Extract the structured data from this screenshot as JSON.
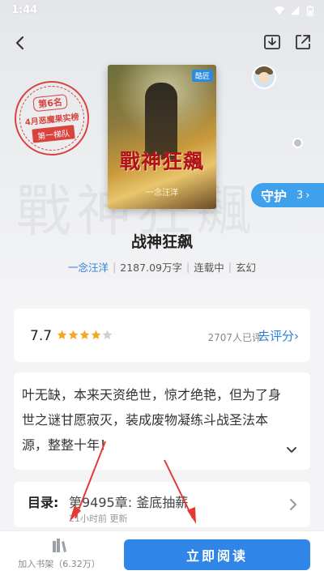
{
  "status_bar": {
    "time": "1:44"
  },
  "seal": {
    "rank": "第6名",
    "list": "4月恶魔果实榜",
    "tier": "第一梯队"
  },
  "cover": {
    "title": "戰神狂飆",
    "badge": "酷匠",
    "author": "一念汪洋"
  },
  "guard": {
    "label": "守护",
    "count": "3"
  },
  "book": {
    "title": "战神狂飙",
    "author": "一念汪洋",
    "word_count": "2187.09万字",
    "status": "连载中",
    "genre": "玄幻"
  },
  "rating": {
    "score": "7.7",
    "stars": 4,
    "count_text": "2707人已评",
    "rate_link": "去评分"
  },
  "description": "叶无缺，本来天资绝世，惊才绝艳，但为了身世之谜甘愿寂灭，装成废物凝练斗战圣法本源，整整十年！",
  "toc": {
    "label": "目录:",
    "chapter": "第9495章: 釜底抽薪",
    "updated": "21小时前 更新"
  },
  "bottom": {
    "shelf_label": "加入书架（6.32万）",
    "read_label": "立即阅读"
  },
  "colors": {
    "accent": "#2f86e6",
    "seal": "#d9433d",
    "annotation_arrow": "#e53935"
  },
  "icons": [
    "back-icon",
    "download-icon",
    "share-icon",
    "chevron-down-icon",
    "chevron-right-icon",
    "bookshelf-icon",
    "star-icon"
  ]
}
